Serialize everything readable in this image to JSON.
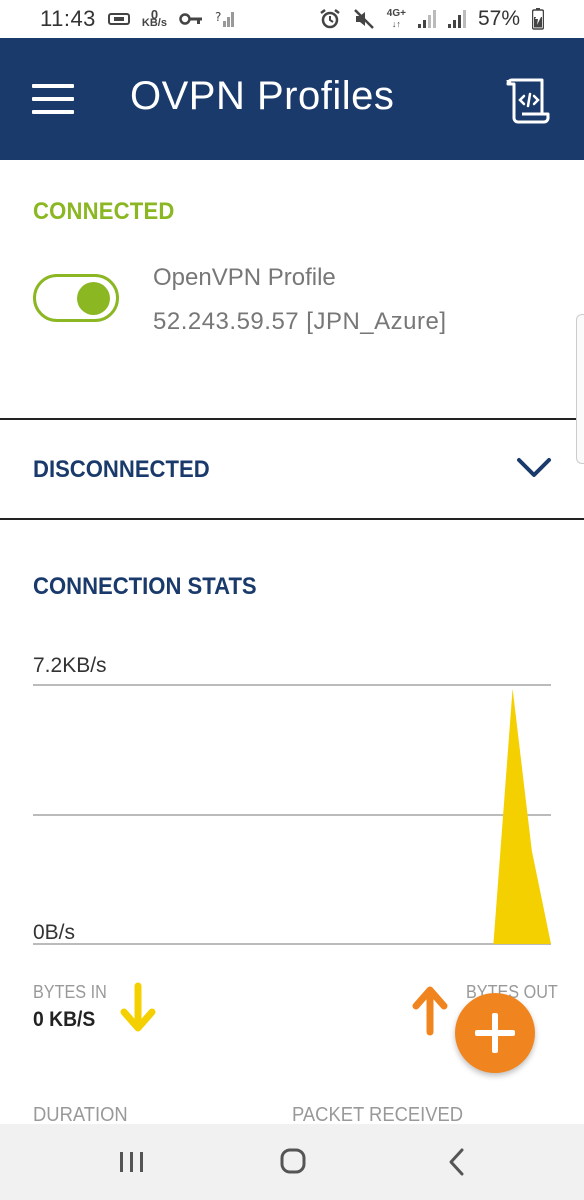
{
  "status_bar": {
    "time": "11:43",
    "data_rate_value": "0",
    "data_rate_unit": "KB/s",
    "network": "4G+",
    "battery": "57%"
  },
  "app_bar": {
    "title": "OVPN Profiles",
    "menu_icon": "hamburger-menu-icon",
    "import_icon": "import-profile-icon"
  },
  "connected": {
    "label": "CONNECTED",
    "toggle_on": true,
    "profile_name": "OpenVPN Profile",
    "server": "52.243.59.57 [JPN_Azure]"
  },
  "disconnected": {
    "label": "DISCONNECTED"
  },
  "stats": {
    "title": "CONNECTION STATS",
    "bytes_in_label": "BYTES IN",
    "bytes_in_value": "0 KB/S",
    "bytes_out_label": "BYTES OUT",
    "duration_label": "DURATION",
    "packet_label": "PACKET RECEIVED"
  },
  "chart_data": {
    "type": "area",
    "y_max_label": "7.2KB/s",
    "y_min_label": "0B/s",
    "ylim": [
      0,
      7.2
    ],
    "series": [
      {
        "values": [
          0,
          0,
          0,
          0,
          0,
          0,
          0,
          0,
          0,
          0,
          0,
          0,
          0,
          0,
          0,
          0,
          0,
          0,
          0,
          0,
          0,
          0,
          0,
          0,
          0,
          7.1,
          2.6,
          0
        ]
      }
    ]
  },
  "colors": {
    "primary": "#1a3a6b",
    "connected_green": "#8bb723",
    "chart_yellow": "#f5d000",
    "accent_orange": "#f0851f"
  }
}
